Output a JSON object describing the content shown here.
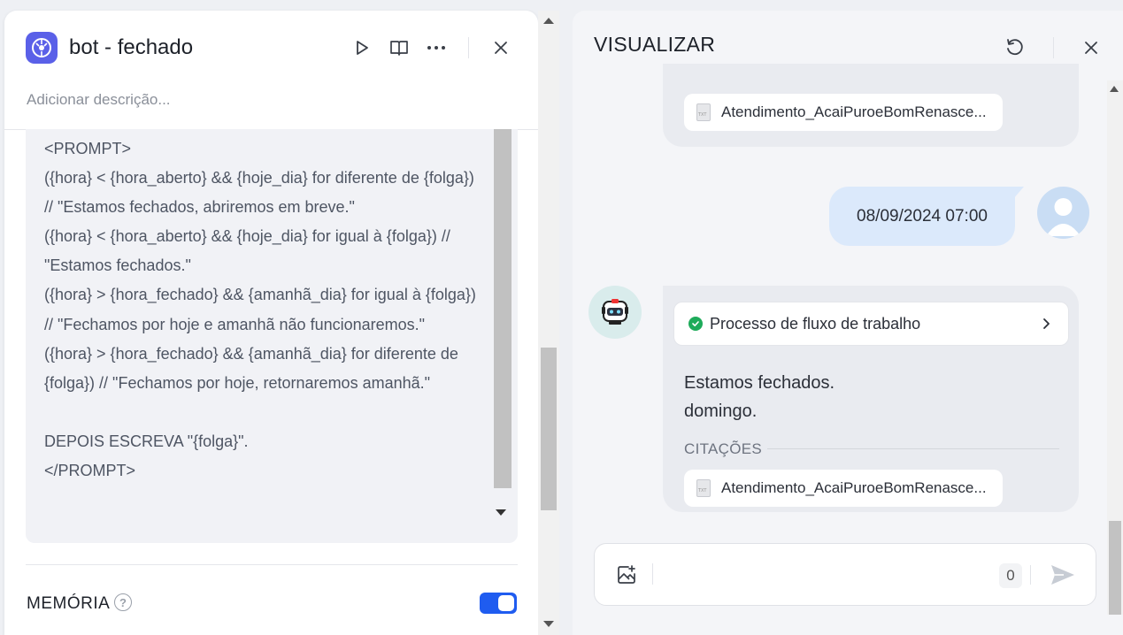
{
  "editor": {
    "title": "bot - fechado",
    "description_placeholder": "Adicionar descrição...",
    "prompt_text": "<PROMPT>\n({hora} < {hora_aberto} && {hoje_dia} for diferente de {folga})  // \"Estamos fechados, abriremos em breve.\"\n({hora} < {hora_aberto} && {hoje_dia} for igual à {folga}) // \"Estamos fechados.\"\n({hora} > {hora_fechado} && {amanhã_dia} for igual à {folga}) // \"Fechamos por hoje e amanhã não funcionaremos.\"\n({hora} > {hora_fechado} && {amanhã_dia} for diferente de {folga}) // \"Fechamos por hoje, retornaremos amanhã.\"\n\nDEPOIS ESCREVA \"{folga}\".\n</PROMPT>",
    "memory_label": "MEMÓRIA",
    "memory_help": "?",
    "memory_enabled": true
  },
  "preview": {
    "title": "VISUALIZAR",
    "top_citation": "Atendimento_AcaiPuroeBomRenasce...",
    "user_message": "08/09/2024 07:00",
    "workflow_label": "Processo de fluxo de trabalho",
    "bot_answer": "Estamos fechados.\ndomingo.",
    "citations_label": "CITAÇÕES",
    "bot_citation": "Atendimento_AcaiPuroeBomRenasce...",
    "input_placeholder": "",
    "char_count": "0"
  },
  "colors": {
    "accent": "#1f5cf0",
    "app_icon": "#5a60e8",
    "user_bubble": "#dbe9fb",
    "bot_bubble": "#e9ebf0",
    "success": "#1eab5a"
  },
  "icons": {
    "run": "play-icon",
    "docs": "book-icon",
    "more": "more-icon",
    "close": "close-icon",
    "reset": "reset-icon",
    "image_upload": "image-add-icon",
    "send": "send-icon"
  }
}
